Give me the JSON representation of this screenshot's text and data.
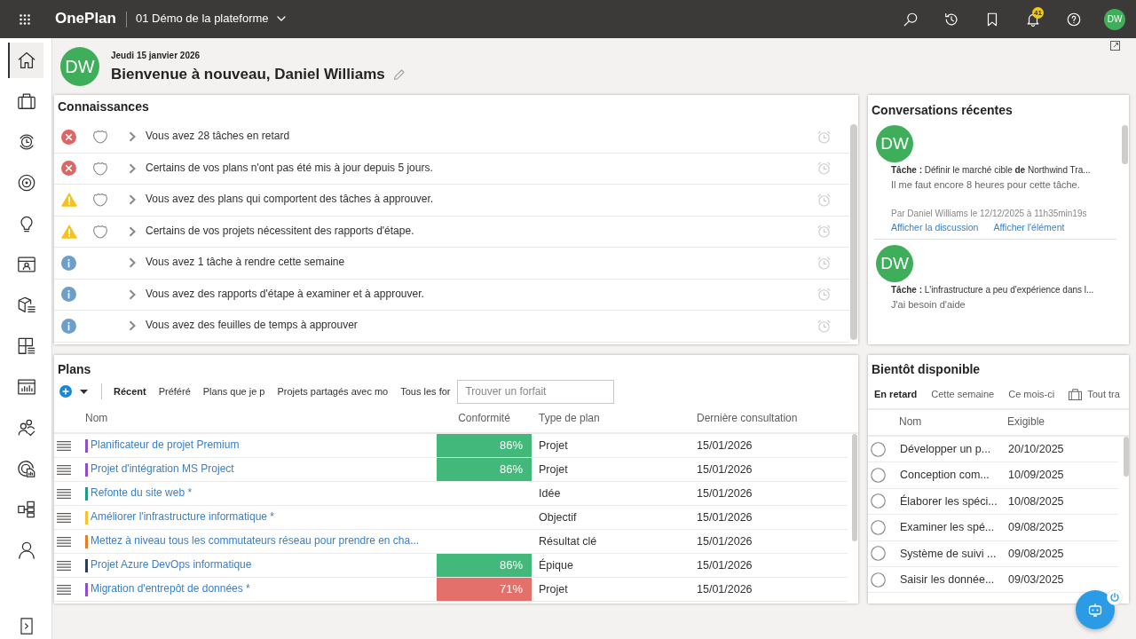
{
  "top_bar": {
    "app_name": "OnePlan",
    "workspace": "01 Démo de la plateforme",
    "notification_count": "41",
    "avatar": "DW"
  },
  "sidebar": {
    "items": [
      {
        "selected": true
      },
      {
        "selected": false
      },
      {
        "selected": false
      },
      {
        "selected": false
      },
      {
        "selected": false
      },
      {
        "selected": false
      },
      {
        "selected": false
      },
      {
        "selected": false
      },
      {
        "selected": false
      },
      {
        "selected": false
      },
      {
        "selected": false
      },
      {
        "selected": false
      },
      {
        "selected": false
      }
    ]
  },
  "header": {
    "avatar": "DW",
    "date": "Jeudi 15 janvier 2026",
    "greeting": "Bienvenue à nouveau, Daniel Williams"
  },
  "insights": {
    "title": "Connaissances",
    "rows": [
      {
        "kind": "error",
        "shield": true,
        "text": "Vous avez 28 tâches en retard"
      },
      {
        "kind": "error",
        "shield": true,
        "text": "Certains de vos plans n'ont pas été mis à jour depuis 5 jours."
      },
      {
        "kind": "warning",
        "shield": true,
        "text": "Vous avez des plans qui comportent des tâches à approuver."
      },
      {
        "kind": "warning",
        "shield": true,
        "text": "Certains de vos projets nécessitent des rapports d'étape."
      },
      {
        "kind": "info",
        "shield": false,
        "text": "Vous avez 1 tâche à rendre cette semaine"
      },
      {
        "kind": "info",
        "shield": false,
        "text": "Vous avez des rapports d'étape à examiner et à approuver."
      },
      {
        "kind": "info",
        "shield": false,
        "text": "Vous avez des feuilles de temps à approuver"
      }
    ]
  },
  "conversations": {
    "title": "Conversations récentes",
    "items": [
      {
        "avatar": "DW",
        "task": "**Tâche :** Définir le marché cible **de** Northwind Tra...",
        "message": "Il me faut encore 8 heures pour cette tâche.",
        "meta": "Par Daniel Williams le 12/12/2025 à 11h35min19s",
        "links": [
          "Afficher la discussion",
          "Afficher l'élément"
        ]
      },
      {
        "avatar": "DW",
        "task": "**Tâche :** L'infrastructure a peu d'expérience dans l...",
        "message": "J'ai besoin d'aide"
      }
    ]
  },
  "plans": {
    "title": "Plans",
    "tabs": [
      {
        "label": "Récent",
        "selected": true
      },
      {
        "label": "Préféré",
        "selected": false
      },
      {
        "label": "Plans que je p",
        "selected": false
      },
      {
        "label": "Projets partagés avec mo",
        "selected": false
      },
      {
        "label": "Tous les for",
        "selected": false
      }
    ],
    "search": {
      "placeholder": "Trouver un forfait"
    },
    "columns": [
      "Nom",
      "Conformité",
      "Type de plan",
      "Dernière consultation"
    ],
    "rows": [
      {
        "name": "Planificateur de projet Premium",
        "color": "#8e4ec6",
        "conformity": "86%",
        "compliant": true,
        "type": "Projet",
        "last_viewed": "15/01/2026"
      },
      {
        "name": "Projet d'intégration MS Project",
        "color": "#8e4ec6",
        "conformity": "86%",
        "compliant": true,
        "type": "Projet",
        "last_viewed": "15/01/2026"
      },
      {
        "name": "Refonte du site web *",
        "color": "#1e9b84",
        "type": "Idée",
        "last_viewed": "15/01/2026"
      },
      {
        "name": "Améliorer l'infrastructure informatique *",
        "color": "#f4c430",
        "type": "Objectif",
        "last_viewed": "15/01/2026"
      },
      {
        "name": "Mettez à niveau tous les commutateurs réseau pour prendre en cha...",
        "color": "#e67e22",
        "type": "Résultat clé",
        "last_viewed": "15/01/2026"
      },
      {
        "name": "Projet Azure DevOps informatique",
        "color": "#2c3e50",
        "conformity": "86%",
        "compliant": true,
        "type": "Épique",
        "last_viewed": "15/01/2026"
      },
      {
        "name": "Migration d'entrepôt de données *",
        "color": "#8e4ec6",
        "conformity": "71%",
        "compliant": false,
        "type": "Projet",
        "last_viewed": "15/01/2026"
      }
    ]
  },
  "upcoming": {
    "title": "Bientôt disponible",
    "tabs": [
      {
        "kind": "plain",
        "label": "En retard",
        "selected": true
      },
      {
        "kind": "plain",
        "label": "Cette semaine",
        "selected": false
      },
      {
        "kind": "plain",
        "label": "Ce mois-ci",
        "selected": false
      },
      {
        "kind": "icon",
        "label": "Tout tra",
        "selected": false
      }
    ],
    "columns": [
      "Nom",
      "Exigible"
    ],
    "rows": [
      {
        "name": "Développer un p...",
        "due": "20/10/2025",
        "checked": false
      },
      {
        "name": "Conception com...",
        "due": "10/09/2025",
        "checked": false
      },
      {
        "name": "Élaborer les spéci...",
        "due": "10/08/2025",
        "checked": false
      },
      {
        "name": "Examiner les spé...",
        "due": "09/08/2025",
        "checked": false
      },
      {
        "name": "Système de suivi ...",
        "due": "09/08/2025",
        "checked": false
      },
      {
        "name": "Saisir les donnée...",
        "due": "09/03/2025",
        "checked": false
      }
    ]
  }
}
